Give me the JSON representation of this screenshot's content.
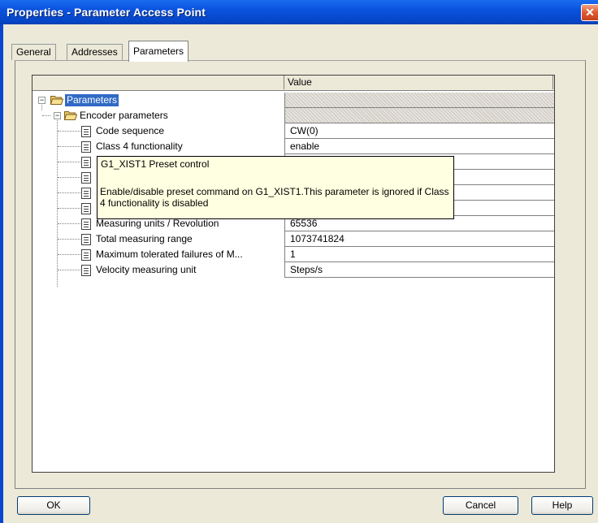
{
  "window": {
    "title": "Properties - Parameter Access Point",
    "close_glyph": "✕"
  },
  "tabs": [
    {
      "label": "General"
    },
    {
      "label": "Addresses"
    },
    {
      "label": "Parameters",
      "active": true
    }
  ],
  "grid": {
    "header": {
      "name_col": "",
      "value_col": "Value"
    },
    "tree": {
      "root": {
        "label": "Parameters",
        "expand": "−",
        "value": ""
      },
      "group": {
        "label": "Encoder parameters",
        "expand": "−",
        "value": ""
      },
      "items": [
        {
          "label": "Code sequence",
          "value": "CW(0)"
        },
        {
          "label": "Class 4 functionality",
          "value": "enable"
        },
        {
          "label": "",
          "value": ""
        },
        {
          "label": "",
          "value": ""
        },
        {
          "label": "",
          "value": ""
        },
        {
          "label": "",
          "value": ""
        },
        {
          "label": "Measuring units / Revolution",
          "value": "65536"
        },
        {
          "label": "Total measuring range",
          "value": "1073741824"
        },
        {
          "label": "Maximum  tolerated failures of M...",
          "value": "1"
        },
        {
          "label": "Velocity measuring unit",
          "value": "Steps/s"
        }
      ]
    }
  },
  "tooltip": {
    "title": "G1_XIST1 Preset control",
    "body": "Enable/disable preset command on G1_XIST1.This parameter is ignored if Class 4 functionality is disabled"
  },
  "buttons": {
    "ok": "OK",
    "cancel": "Cancel",
    "help": "Help"
  }
}
